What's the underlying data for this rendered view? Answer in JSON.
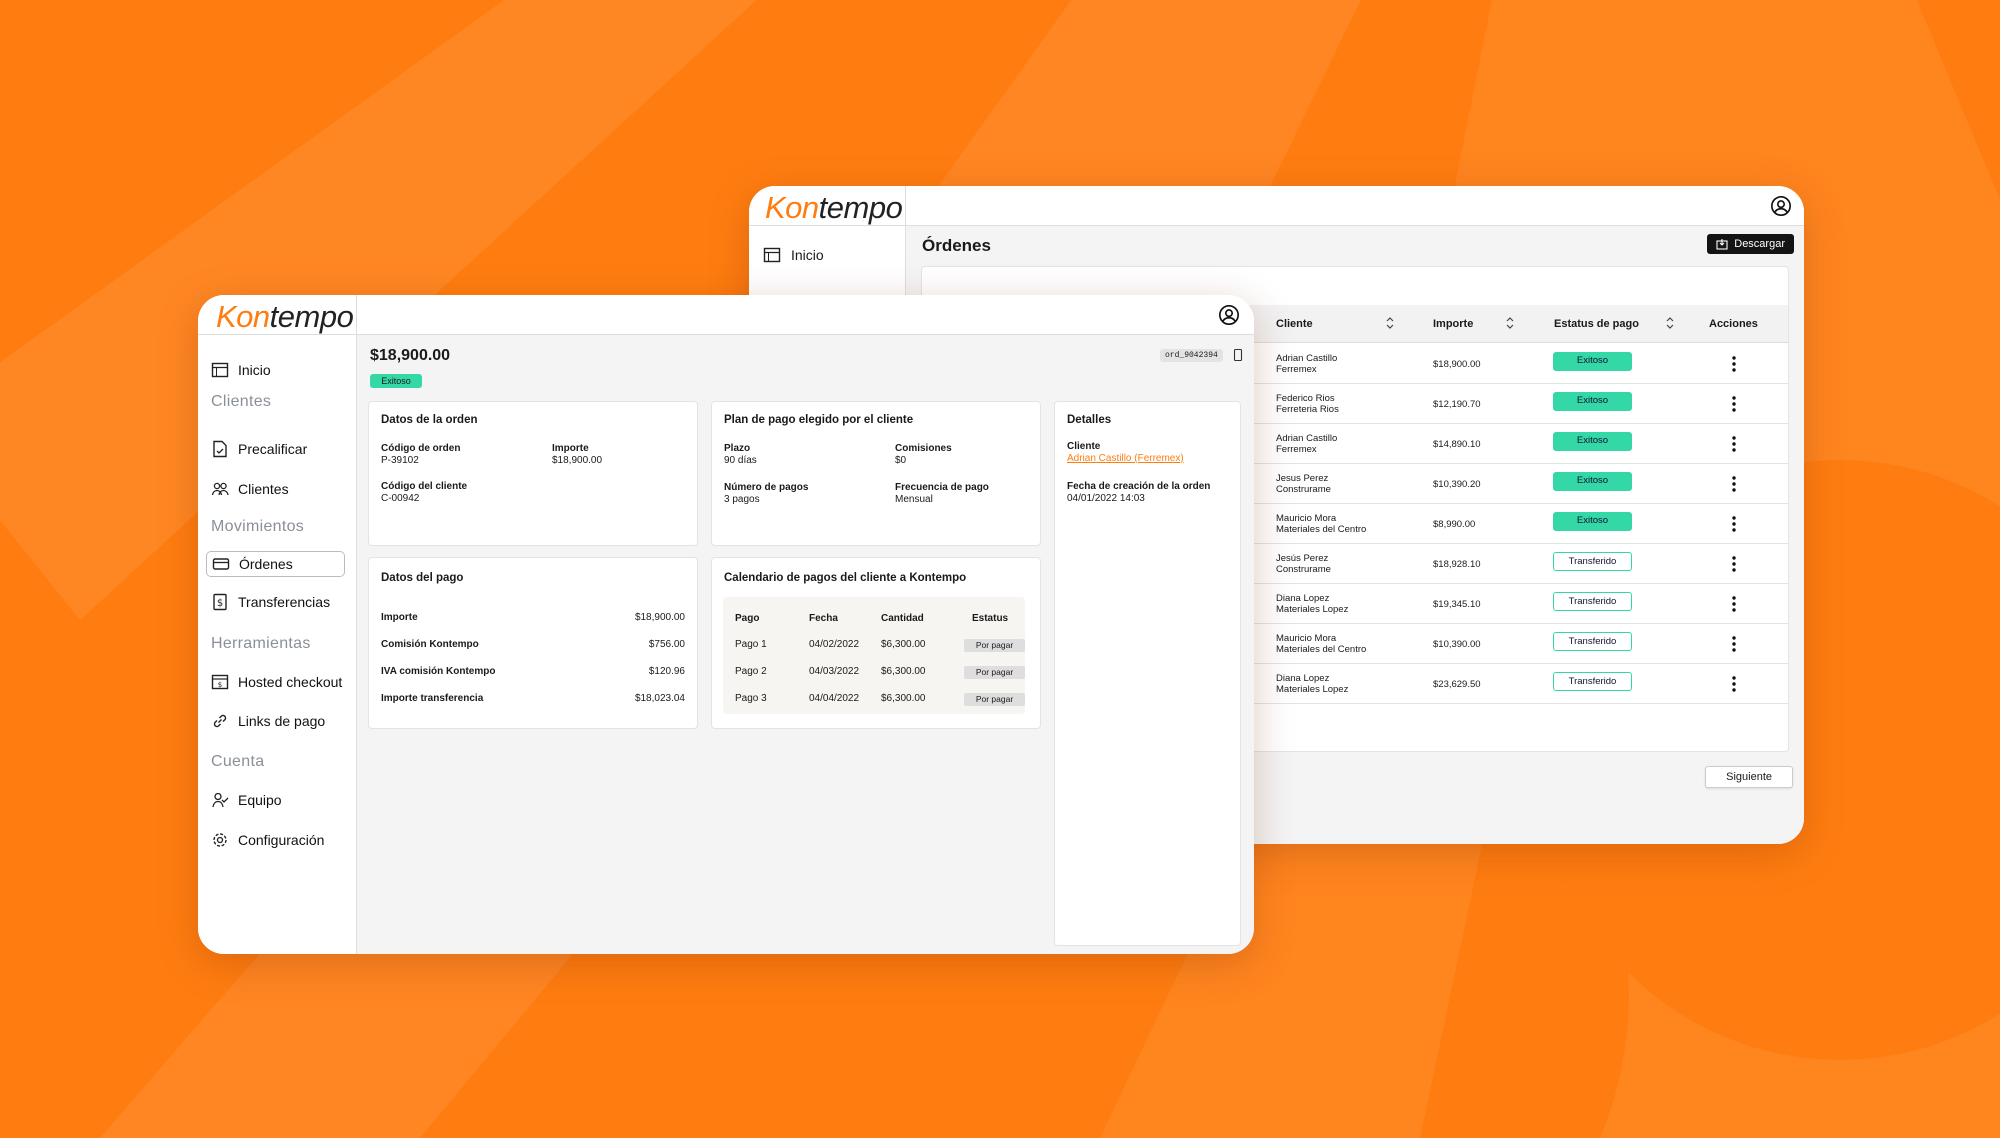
{
  "brand": {
    "logo_k": "Kon",
    "logo_t": "tempo",
    "accent": "#ff7d10",
    "success": "#34d8a7"
  },
  "back": {
    "nav_inicio": "Inicio",
    "page_title": "Órdenes",
    "download_label": "Descargar",
    "columns": [
      "Cliente",
      "Importe",
      "Estatus de pago",
      "Acciones"
    ],
    "rows": [
      {
        "name": "Adrian Castillo",
        "company": "Ferremex",
        "amount": "$18,900.00",
        "status": "Exitoso"
      },
      {
        "name": "Federico Rios",
        "company": "Ferreteria Rios",
        "amount": "$12,190.70",
        "status": "Exitoso"
      },
      {
        "name": "Adrian Castillo",
        "company": "Ferremex",
        "amount": "$14,890.10",
        "status": "Exitoso"
      },
      {
        "name": "Jesus Perez",
        "company": "Construrame",
        "amount": "$10,390.20",
        "status": "Exitoso"
      },
      {
        "name": "Mauricio Mora",
        "company": "Materiales del Centro",
        "amount": "$8,990.00",
        "status": "Exitoso"
      },
      {
        "name": "Jesús Perez",
        "company": "Construrame",
        "amount": "$18,928.10",
        "status": "Transferido"
      },
      {
        "name": "Diana Lopez",
        "company": "Materiales Lopez",
        "amount": "$19,345.10",
        "status": "Transferido"
      },
      {
        "name": "Mauricio Mora",
        "company": "Materiales del Centro",
        "amount": "$10,390.00",
        "status": "Transferido"
      },
      {
        "name": "Diana Lopez",
        "company": "Materiales Lopez",
        "amount": "$23,629.50",
        "status": "Transferido"
      }
    ],
    "next_label": "Siguiente"
  },
  "front": {
    "nav": {
      "inicio": "Inicio",
      "sec_clientes": "Clientes",
      "precalificar": "Precalificar",
      "clientes": "Clientes",
      "sec_movimientos": "Movimientos",
      "ordenes": "Órdenes",
      "transferencias": "Transferencias",
      "sec_herramientas": "Herramientas",
      "hosted": "Hosted checkout",
      "links": "Links de pago",
      "sec_cuenta": "Cuenta",
      "equipo": "Equipo",
      "config": "Configuración"
    },
    "amount": "$18,900.00",
    "status": "Exitoso",
    "order_id": "ord_9042394",
    "orden": {
      "title": "Datos de la orden",
      "codigo_label": "Código de orden",
      "codigo": "P-39102",
      "importe_label": "Importe",
      "importe": "$18,900.00",
      "cliente_label": "Código del cliente",
      "cliente": "C-00942"
    },
    "plan": {
      "title": "Plan de pago elegido por el cliente",
      "plazo_label": "Plazo",
      "plazo": "90 días",
      "comisiones_label": "Comisiones",
      "comisiones": "$0",
      "num_label": "Número de pagos",
      "num": "3 pagos",
      "freq_label": "Frecuencia de pago",
      "freq": "Mensual"
    },
    "detalles": {
      "title": "Detalles",
      "cliente_label": "Cliente",
      "cliente": "Adrian Castillo (Ferremex)",
      "fecha_label": "Fecha de creación de la orden",
      "fecha": "04/01/2022 14:03"
    },
    "pago": {
      "title": "Datos del pago",
      "rows": [
        {
          "label": "Importe",
          "value": "$18,900.00"
        },
        {
          "label": "Comisión Kontempo",
          "value": "$756.00"
        },
        {
          "label": "IVA comisión Kontempo",
          "value": "$120.96"
        },
        {
          "label": "Importe transferencia",
          "value": "$18,023.04"
        }
      ]
    },
    "calendario": {
      "title": "Calendario de pagos del cliente a Kontempo",
      "headers": [
        "Pago",
        "Fecha",
        "Cantidad",
        "Estatus"
      ],
      "rows": [
        {
          "pago": "Pago 1",
          "fecha": "04/02/2022",
          "cantidad": "$6,300.00",
          "estatus": "Por pagar"
        },
        {
          "pago": "Pago 2",
          "fecha": "04/03/2022",
          "cantidad": "$6,300.00",
          "estatus": "Por pagar"
        },
        {
          "pago": "Pago 3",
          "fecha": "04/04/2022",
          "cantidad": "$6,300.00",
          "estatus": "Por pagar"
        }
      ]
    }
  }
}
